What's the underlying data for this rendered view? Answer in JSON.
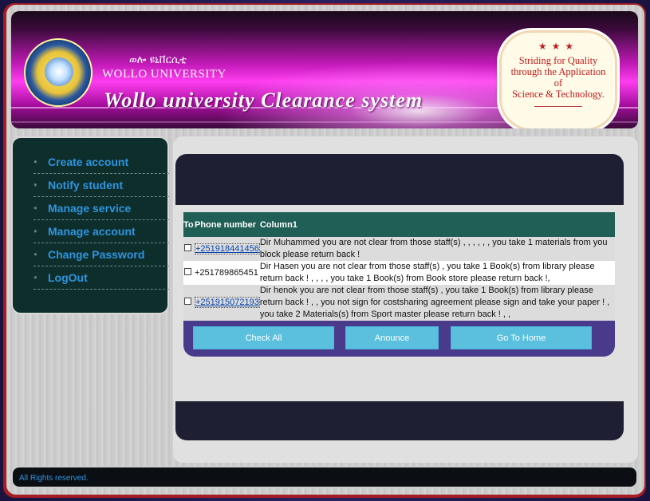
{
  "header": {
    "amharic_name": "ወሎ ዩኒቨርሲቲ",
    "university_name": "WOLLO UNIVERSITY",
    "system_title": "Wollo university Clearance system",
    "motto": {
      "line1": "Striding for Quality",
      "line2": "through the Application",
      "line3": "of",
      "line4": "Science & Technology."
    }
  },
  "sidebar": {
    "items": [
      {
        "label": "Create account"
      },
      {
        "label": "Notify student"
      },
      {
        "label": "Manage service"
      },
      {
        "label": "Manage account"
      },
      {
        "label": "Change Password"
      },
      {
        "label": "LogOut"
      }
    ]
  },
  "table": {
    "headers": {
      "to": "To",
      "phone": "Phone number",
      "column1": "Column1"
    },
    "rows": [
      {
        "phone": "+251918441456",
        "linked": true,
        "message": "Dir Muhammed you are not clear from those staff(s) , , , , , , you take 1 materials from you block please return back !"
      },
      {
        "phone": "+251789865451",
        "linked": false,
        "message": "Dir Hasen you are not clear from those staff(s) , you take 1 Book(s) from library please return back ! , , , , you take 1 Book(s) from Book store please return back !,"
      },
      {
        "phone": "+251915072193",
        "linked": true,
        "message": "Dir henok you are not clear from those staff(s) , you take 1 Book(s) from library please return back ! , , you not sign for costsharing agreement please sign and take your paper ! , you take 2 Materials(s) from Sport master please return back ! , ,"
      }
    ]
  },
  "actions": {
    "check_all": "Check All",
    "anounce": "Anounce",
    "go_home": "Go To Home"
  },
  "footer": {
    "text": "All Rights reserved."
  },
  "colors": {
    "frame": "#a51c23",
    "sidebar_bg": "#0d2e2b",
    "link": "#2f95e0",
    "table_header": "#1f5f55",
    "button": "#5bc0de",
    "action_bar": "#4a3a8c"
  }
}
